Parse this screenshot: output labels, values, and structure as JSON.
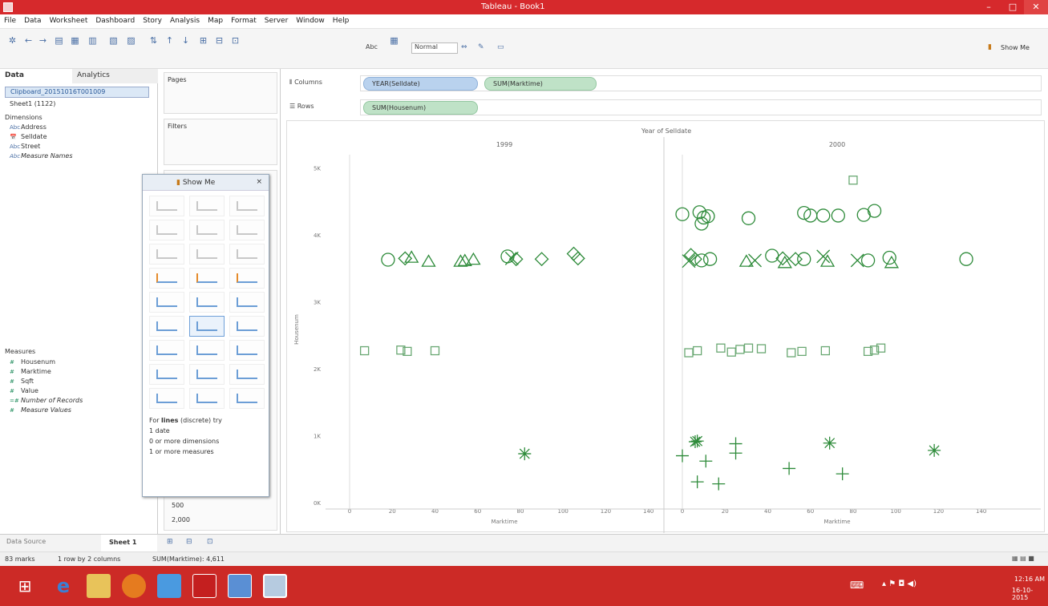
{
  "window": {
    "title": "Tableau - Book1"
  },
  "menu": [
    "File",
    "Data",
    "Worksheet",
    "Dashboard",
    "Story",
    "Analysis",
    "Map",
    "Format",
    "Server",
    "Window",
    "Help"
  ],
  "toolbar": {
    "fit_value": "Normal",
    "abc_label": "Abc",
    "show_me_label": "Show Me"
  },
  "data_pane": {
    "tab_data": "Data",
    "tab_analytics": "Analytics",
    "datasource": "Clipboard_20151016T001009",
    "sheet_source": "Sheet1 (1122)",
    "dimensions_header": "Dimensions",
    "dimensions": [
      {
        "type": "Abc",
        "name": "Address"
      },
      {
        "type": "📅",
        "name": "Selldate"
      },
      {
        "type": "Abc",
        "name": "Street"
      },
      {
        "type": "Abc",
        "name": "Measure Names"
      }
    ],
    "measures_header": "Measures",
    "measures": [
      {
        "type": "#",
        "name": "Housenum"
      },
      {
        "type": "#",
        "name": "Marktime"
      },
      {
        "type": "#",
        "name": "Sqft"
      },
      {
        "type": "#",
        "name": "Value"
      },
      {
        "type": "=#",
        "name": "Number of Records"
      },
      {
        "type": "#",
        "name": "Measure Values"
      }
    ]
  },
  "cards": {
    "pages": "Pages",
    "filters": "Filters",
    "size_values": [
      "500",
      "2,000"
    ]
  },
  "show_me": {
    "title": "Show Me",
    "hint_line1_pre": "For",
    "hint_line1_bold": "lines",
    "hint_line1_post": "(discrete) try",
    "hint_items": [
      "1 date",
      "0 or more dimensions",
      "1 or more measures"
    ]
  },
  "shelves": {
    "columns_label": "Columns",
    "rows_label": "Rows",
    "columns_pills": [
      "YEAR(Selldate)",
      "SUM(Marktime)"
    ],
    "rows_pills": [
      "SUM(Housenum)"
    ]
  },
  "chart_data": {
    "type": "scatter",
    "title": "Year of Selldate",
    "panes": [
      "1999",
      "2000"
    ],
    "xlabel": "Marktime",
    "ylabel": "Housenum",
    "x_ticks": [
      0,
      20,
      40,
      60,
      80,
      100,
      120,
      140
    ],
    "y_ticks": [
      "0K",
      "1K",
      "2K",
      "3K",
      "4K",
      "5K"
    ],
    "ylim": [
      0,
      5200
    ],
    "points": [
      {
        "pane": 0,
        "x": 18,
        "y": 3630,
        "m": "circle"
      },
      {
        "pane": 0,
        "x": 26,
        "y": 3650,
        "m": "diamond"
      },
      {
        "pane": 0,
        "x": 29,
        "y": 3660,
        "m": "triangle"
      },
      {
        "pane": 0,
        "x": 37,
        "y": 3600,
        "m": "triangle"
      },
      {
        "pane": 0,
        "x": 52,
        "y": 3600,
        "m": "triangle"
      },
      {
        "pane": 0,
        "x": 54,
        "y": 3610,
        "m": "triangle"
      },
      {
        "pane": 0,
        "x": 58,
        "y": 3630,
        "m": "triangle"
      },
      {
        "pane": 0,
        "x": 74,
        "y": 3680,
        "m": "circle"
      },
      {
        "pane": 0,
        "x": 76,
        "y": 3650,
        "m": "x"
      },
      {
        "pane": 0,
        "x": 78,
        "y": 3640,
        "m": "diamond"
      },
      {
        "pane": 0,
        "x": 90,
        "y": 3640,
        "m": "diamond"
      },
      {
        "pane": 0,
        "x": 105,
        "y": 3720,
        "m": "diamond"
      },
      {
        "pane": 0,
        "x": 107,
        "y": 3650,
        "m": "diamond"
      },
      {
        "pane": 0,
        "x": 7,
        "y": 2270,
        "m": "square"
      },
      {
        "pane": 0,
        "x": 24,
        "y": 2280,
        "m": "square"
      },
      {
        "pane": 0,
        "x": 27,
        "y": 2260,
        "m": "square"
      },
      {
        "pane": 0,
        "x": 40,
        "y": 2270,
        "m": "square"
      },
      {
        "pane": 0,
        "x": 82,
        "y": 730,
        "m": "star"
      },
      {
        "pane": 1,
        "x": 80,
        "y": 4820,
        "m": "square"
      },
      {
        "pane": 1,
        "x": 0,
        "y": 4310,
        "m": "circle"
      },
      {
        "pane": 1,
        "x": 8,
        "y": 4340,
        "m": "circle"
      },
      {
        "pane": 1,
        "x": 10,
        "y": 4260,
        "m": "circle"
      },
      {
        "pane": 1,
        "x": 12,
        "y": 4280,
        "m": "circle"
      },
      {
        "pane": 1,
        "x": 9,
        "y": 4170,
        "m": "circle"
      },
      {
        "pane": 1,
        "x": 31,
        "y": 4250,
        "m": "circle"
      },
      {
        "pane": 1,
        "x": 57,
        "y": 4330,
        "m": "circle"
      },
      {
        "pane": 1,
        "x": 60,
        "y": 4290,
        "m": "circle"
      },
      {
        "pane": 1,
        "x": 66,
        "y": 4290,
        "m": "circle"
      },
      {
        "pane": 1,
        "x": 73,
        "y": 4290,
        "m": "circle"
      },
      {
        "pane": 1,
        "x": 85,
        "y": 4300,
        "m": "circle"
      },
      {
        "pane": 1,
        "x": 90,
        "y": 4360,
        "m": "circle"
      },
      {
        "pane": 1,
        "x": 4,
        "y": 3700,
        "m": "diamond"
      },
      {
        "pane": 1,
        "x": 3,
        "y": 3610,
        "m": "x"
      },
      {
        "pane": 1,
        "x": 6,
        "y": 3640,
        "m": "diamond"
      },
      {
        "pane": 1,
        "x": 9,
        "y": 3620,
        "m": "circle"
      },
      {
        "pane": 1,
        "x": 13,
        "y": 3640,
        "m": "circle"
      },
      {
        "pane": 1,
        "x": 30,
        "y": 3600,
        "m": "triangle"
      },
      {
        "pane": 1,
        "x": 34,
        "y": 3620,
        "m": "x"
      },
      {
        "pane": 1,
        "x": 42,
        "y": 3690,
        "m": "circle"
      },
      {
        "pane": 1,
        "x": 47,
        "y": 3650,
        "m": "diamond"
      },
      {
        "pane": 1,
        "x": 48,
        "y": 3580,
        "m": "triangle"
      },
      {
        "pane": 1,
        "x": 53,
        "y": 3640,
        "m": "diamond"
      },
      {
        "pane": 1,
        "x": 57,
        "y": 3640,
        "m": "circle"
      },
      {
        "pane": 1,
        "x": 66,
        "y": 3680,
        "m": "x"
      },
      {
        "pane": 1,
        "x": 68,
        "y": 3600,
        "m": "triangle"
      },
      {
        "pane": 1,
        "x": 82,
        "y": 3620,
        "m": "x"
      },
      {
        "pane": 1,
        "x": 87,
        "y": 3620,
        "m": "circle"
      },
      {
        "pane": 1,
        "x": 97,
        "y": 3660,
        "m": "circle"
      },
      {
        "pane": 1,
        "x": 98,
        "y": 3580,
        "m": "triangle"
      },
      {
        "pane": 1,
        "x": 133,
        "y": 3640,
        "m": "circle"
      },
      {
        "pane": 1,
        "x": 3,
        "y": 2240,
        "m": "square"
      },
      {
        "pane": 1,
        "x": 7,
        "y": 2270,
        "m": "square"
      },
      {
        "pane": 1,
        "x": 18,
        "y": 2310,
        "m": "square"
      },
      {
        "pane": 1,
        "x": 23,
        "y": 2250,
        "m": "square"
      },
      {
        "pane": 1,
        "x": 27,
        "y": 2290,
        "m": "square"
      },
      {
        "pane": 1,
        "x": 31,
        "y": 2310,
        "m": "square"
      },
      {
        "pane": 1,
        "x": 37,
        "y": 2300,
        "m": "square"
      },
      {
        "pane": 1,
        "x": 51,
        "y": 2240,
        "m": "square"
      },
      {
        "pane": 1,
        "x": 56,
        "y": 2260,
        "m": "square"
      },
      {
        "pane": 1,
        "x": 67,
        "y": 2270,
        "m": "square"
      },
      {
        "pane": 1,
        "x": 87,
        "y": 2260,
        "m": "square"
      },
      {
        "pane": 1,
        "x": 90,
        "y": 2280,
        "m": "square"
      },
      {
        "pane": 1,
        "x": 93,
        "y": 2310,
        "m": "square"
      },
      {
        "pane": 1,
        "x": 6,
        "y": 910,
        "m": "star"
      },
      {
        "pane": 1,
        "x": 7,
        "y": 920,
        "m": "star"
      },
      {
        "pane": 1,
        "x": 69,
        "y": 890,
        "m": "star"
      },
      {
        "pane": 1,
        "x": 118,
        "y": 780,
        "m": "star"
      },
      {
        "pane": 1,
        "x": 0,
        "y": 700,
        "m": "plus"
      },
      {
        "pane": 1,
        "x": 11,
        "y": 620,
        "m": "plus"
      },
      {
        "pane": 1,
        "x": 25,
        "y": 880,
        "m": "plus"
      },
      {
        "pane": 1,
        "x": 25,
        "y": 740,
        "m": "plus"
      },
      {
        "pane": 1,
        "x": 50,
        "y": 510,
        "m": "plus"
      },
      {
        "pane": 1,
        "x": 75,
        "y": 430,
        "m": "plus"
      },
      {
        "pane": 1,
        "x": 7,
        "y": 310,
        "m": "plus"
      },
      {
        "pane": 1,
        "x": 17,
        "y": 280,
        "m": "plus"
      }
    ]
  },
  "sheet_tabs": {
    "data_source": "Data Source",
    "sheet1": "Sheet 1"
  },
  "status": {
    "marks": "83 marks",
    "layout": "1 row by 2 columns",
    "sum": "SUM(Marktime): 4,611"
  },
  "taskbar": {
    "time": "12:16 AM",
    "date": "16-10-2015"
  },
  "colors": {
    "mark": "#2e8b3a",
    "titlebar": "#d6292c",
    "taskbar": "#cc2a26"
  }
}
